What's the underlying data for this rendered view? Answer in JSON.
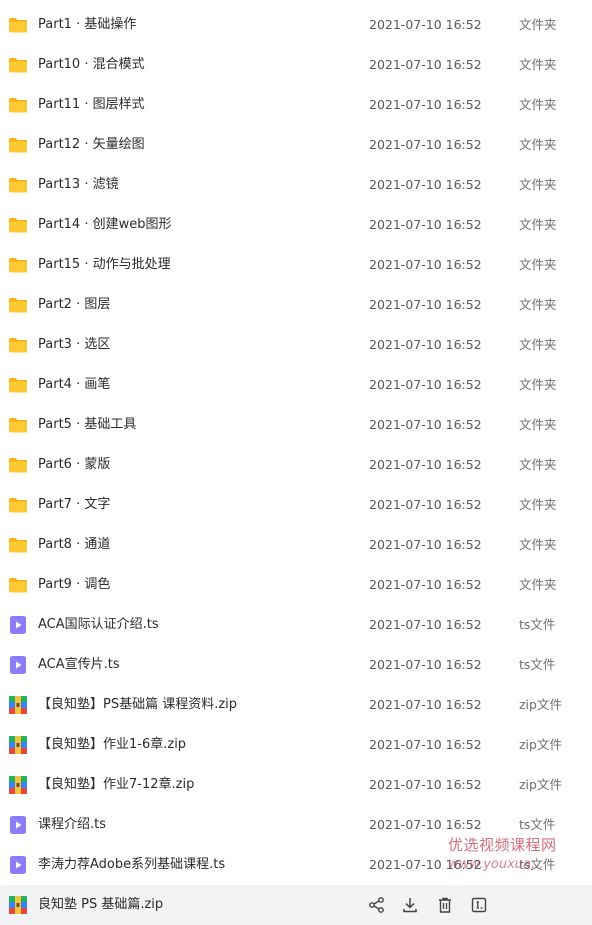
{
  "files": [
    {
      "icon": "folder-icon",
      "name": "Part1 · 基础操作",
      "date": "2021-07-10 16:52",
      "type": "文件夹"
    },
    {
      "icon": "folder-icon",
      "name": "Part10 · 混合模式",
      "date": "2021-07-10 16:52",
      "type": "文件夹"
    },
    {
      "icon": "folder-icon",
      "name": "Part11 · 图层样式",
      "date": "2021-07-10 16:52",
      "type": "文件夹"
    },
    {
      "icon": "folder-icon",
      "name": "Part12 · 矢量绘图",
      "date": "2021-07-10 16:52",
      "type": "文件夹"
    },
    {
      "icon": "folder-icon",
      "name": "Part13 · 滤镜",
      "date": "2021-07-10 16:52",
      "type": "文件夹"
    },
    {
      "icon": "folder-icon",
      "name": "Part14 · 创建web图形",
      "date": "2021-07-10 16:52",
      "type": "文件夹"
    },
    {
      "icon": "folder-icon",
      "name": "Part15 · 动作与批处理",
      "date": "2021-07-10 16:52",
      "type": "文件夹"
    },
    {
      "icon": "folder-icon",
      "name": "Part2 · 图层",
      "date": "2021-07-10 16:52",
      "type": "文件夹"
    },
    {
      "icon": "folder-icon",
      "name": "Part3 · 选区",
      "date": "2021-07-10 16:52",
      "type": "文件夹"
    },
    {
      "icon": "folder-icon",
      "name": "Part4 · 画笔",
      "date": "2021-07-10 16:52",
      "type": "文件夹"
    },
    {
      "icon": "folder-icon",
      "name": "Part5 · 基础工具",
      "date": "2021-07-10 16:52",
      "type": "文件夹"
    },
    {
      "icon": "folder-icon",
      "name": "Part6 · 蒙版",
      "date": "2021-07-10 16:52",
      "type": "文件夹"
    },
    {
      "icon": "folder-icon",
      "name": "Part7 · 文字",
      "date": "2021-07-10 16:52",
      "type": "文件夹"
    },
    {
      "icon": "folder-icon",
      "name": "Part8 · 通道",
      "date": "2021-07-10 16:52",
      "type": "文件夹"
    },
    {
      "icon": "folder-icon",
      "name": "Part9 · 调色",
      "date": "2021-07-10 16:52",
      "type": "文件夹"
    },
    {
      "icon": "video-file-icon",
      "name": "ACA国际认证介绍.ts",
      "date": "2021-07-10 16:52",
      "type": "ts文件"
    },
    {
      "icon": "video-file-icon",
      "name": "ACA宣传片.ts",
      "date": "2021-07-10 16:52",
      "type": "ts文件"
    },
    {
      "icon": "zip-file-icon",
      "name": "【良知塾】PS基础篇 课程资料.zip",
      "date": "2021-07-10 16:52",
      "type": "zip文件"
    },
    {
      "icon": "zip-file-icon",
      "name": "【良知塾】作业1-6章.zip",
      "date": "2021-07-10 16:52",
      "type": "zip文件"
    },
    {
      "icon": "zip-file-icon",
      "name": "【良知塾】作业7-12章.zip",
      "date": "2021-07-10 16:52",
      "type": "zip文件"
    },
    {
      "icon": "video-file-icon",
      "name": "课程介绍.ts",
      "date": "2021-07-10 16:52",
      "type": "ts文件"
    },
    {
      "icon": "video-file-icon",
      "name": "李涛力荐Adobe系列基础课程.ts",
      "date": "2021-07-10 16:52",
      "type": "ts文件"
    },
    {
      "icon": "zip-file-icon",
      "name": "良知塾 PS 基础篇.zip",
      "date": "",
      "type": "",
      "hovered": true
    }
  ],
  "row_actions": [
    "share-icon",
    "download-icon",
    "delete-icon",
    "rename-icon"
  ],
  "watermark": {
    "line1": "优选视频课程网",
    "line2": "www.youxua..."
  },
  "colors": {
    "folder": "#ffc933",
    "folder_back": "#f6b21a",
    "video": "#8b7cf6",
    "hover_bg": "#f2f3f5"
  }
}
